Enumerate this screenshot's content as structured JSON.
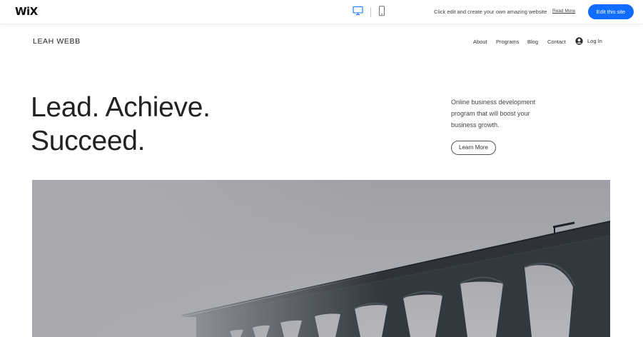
{
  "editor_bar": {
    "logo": "WiX",
    "message": "Click edit and create your own amazing website",
    "read_more": "Read More",
    "edit_button": "Edit this site",
    "icons": [
      "desktop-icon",
      "mobile-icon"
    ]
  },
  "site": {
    "name": "LEAH WEBB",
    "nav": [
      "About",
      "Programs",
      "Blog",
      "Contact"
    ],
    "login": "Log In"
  },
  "hero": {
    "headline_line1": "Lead. Achieve.",
    "headline_line2": "Succeed.",
    "description": "Online business development program that will boost your business growth.",
    "button": "Learn More"
  },
  "colors": {
    "accent": "#116dff",
    "text": "#222222",
    "fog": "#a6a9b0"
  }
}
